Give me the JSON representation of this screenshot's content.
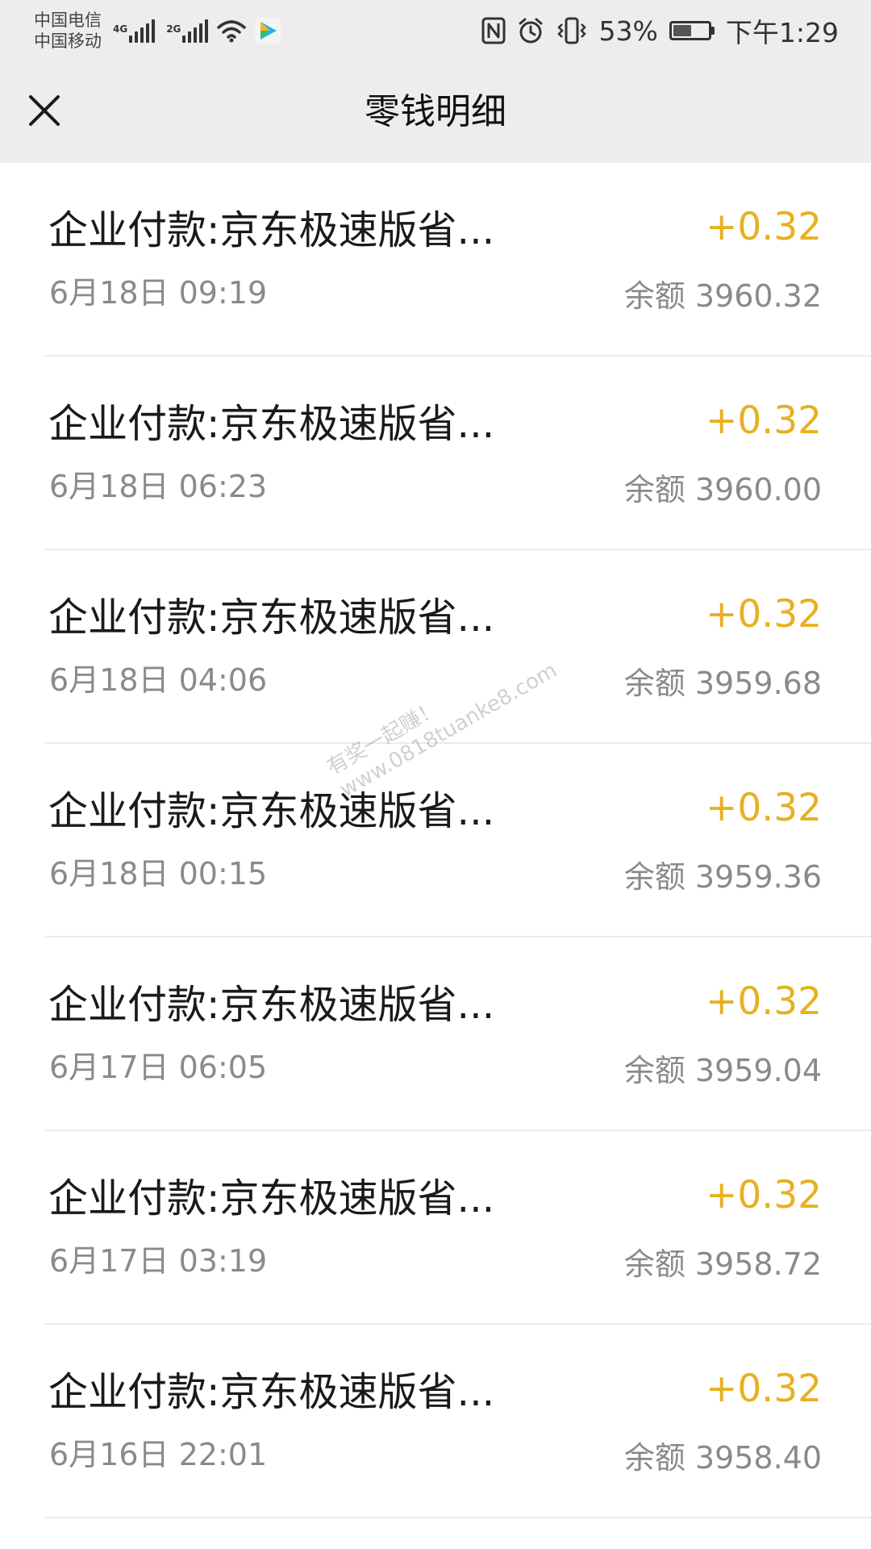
{
  "status_bar": {
    "carrier_1": "中国电信",
    "carrier_2": "中国移动",
    "signal_1_tag": "4G",
    "signal_2_tag": "2G",
    "battery": "53%",
    "time": "下午1:29",
    "icons": [
      "signal-icon",
      "wifi-icon",
      "app-icon",
      "nfc-icon",
      "alarm-icon",
      "vibrate-icon",
      "battery-icon"
    ]
  },
  "nav": {
    "title": "零钱明细",
    "close_icon": "close-icon"
  },
  "watermark": {
    "line_1": "有奖一起赚！",
    "line_2": "www.0818tuanke8.com"
  },
  "transactions": [
    {
      "title": "企业付款:京东极速版省...",
      "time": "6月18日 09:19",
      "amount": "+0.32",
      "balance_label": "余额",
      "balance": "3960.32"
    },
    {
      "title": "企业付款:京东极速版省...",
      "time": "6月18日 06:23",
      "amount": "+0.32",
      "balance_label": "余额",
      "balance": "3960.00"
    },
    {
      "title": "企业付款:京东极速版省...",
      "time": "6月18日 04:06",
      "amount": "+0.32",
      "balance_label": "余额",
      "balance": "3959.68"
    },
    {
      "title": "企业付款:京东极速版省...",
      "time": "6月18日 00:15",
      "amount": "+0.32",
      "balance_label": "余额",
      "balance": "3959.36"
    },
    {
      "title": "企业付款:京东极速版省...",
      "time": "6月17日 06:05",
      "amount": "+0.32",
      "balance_label": "余额",
      "balance": "3959.04"
    },
    {
      "title": "企业付款:京东极速版省...",
      "time": "6月17日 03:19",
      "amount": "+0.32",
      "balance_label": "余额",
      "balance": "3958.72"
    },
    {
      "title": "企业付款:京东极速版省...",
      "time": "6月16日 22:01",
      "amount": "+0.32",
      "balance_label": "余额",
      "balance": "3958.40"
    }
  ],
  "colors": {
    "header_bg": "#ededed",
    "amount": "#e8b020",
    "secondary_text": "#8a8a8a",
    "divider": "#ebebeb"
  }
}
